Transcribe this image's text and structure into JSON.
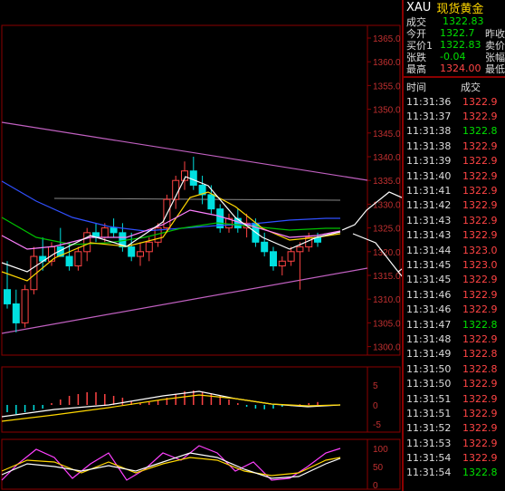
{
  "symbol": {
    "code": "XAU",
    "name": "现货黄金"
  },
  "quote": [
    {
      "label": "成交",
      "value": "1322.83",
      "value_color": "#00e000",
      "label2": ""
    },
    {
      "label": "今开",
      "value": "1322.7",
      "value_color": "#00e000",
      "label2": "昨收"
    },
    {
      "label": "买价1",
      "value": "1322.83",
      "value_color": "#00e000",
      "label2": "卖价"
    },
    {
      "label": "张跌",
      "value": "-0.04",
      "value_color": "#00e000",
      "label2": "张幅"
    },
    {
      "label": "最高",
      "value": "1324.00",
      "value_color": "#ff4444",
      "label2": "最低"
    }
  ],
  "ticks_header": {
    "time": "时间",
    "price": "成交"
  },
  "ticks": [
    {
      "time": "11:31:36",
      "price": "1322.9",
      "color": "#ff4444"
    },
    {
      "time": "11:31:37",
      "price": "1322.9",
      "color": "#ff4444"
    },
    {
      "time": "11:31:38",
      "price": "1322.8",
      "color": "#00e000"
    },
    {
      "time": "11:31:38",
      "price": "1322.9",
      "color": "#ff4444"
    },
    {
      "time": "11:31:39",
      "price": "1322.9",
      "color": "#ff4444"
    },
    {
      "time": "11:31:40",
      "price": "1322.9",
      "color": "#ff4444"
    },
    {
      "time": "11:31:41",
      "price": "1322.9",
      "color": "#ff4444"
    },
    {
      "time": "11:31:42",
      "price": "1322.9",
      "color": "#ff4444"
    },
    {
      "time": "11:31:43",
      "price": "1322.9",
      "color": "#ff4444"
    },
    {
      "time": "11:31:43",
      "price": "1322.9",
      "color": "#ff4444"
    },
    {
      "time": "11:31:44",
      "price": "1323.0",
      "color": "#ff4444"
    },
    {
      "time": "11:31:45",
      "price": "1323.0",
      "color": "#ff4444"
    },
    {
      "time": "11:31:45",
      "price": "1322.9",
      "color": "#ff4444"
    },
    {
      "time": "11:31:46",
      "price": "1322.9",
      "color": "#ff4444"
    },
    {
      "time": "11:31:46",
      "price": "1322.9",
      "color": "#ff4444"
    },
    {
      "time": "11:31:47",
      "price": "1322.8",
      "color": "#00e000"
    },
    {
      "time": "11:31:48",
      "price": "1322.9",
      "color": "#ff4444"
    },
    {
      "time": "11:31:49",
      "price": "1322.8",
      "color": "#ff4444"
    },
    {
      "time": "11:31:50",
      "price": "1322.8",
      "color": "#ff4444"
    },
    {
      "time": "11:31:50",
      "price": "1322.9",
      "color": "#ff4444"
    },
    {
      "time": "11:31:51",
      "price": "1322.9",
      "color": "#ff4444"
    },
    {
      "time": "11:31:51",
      "price": "1322.9",
      "color": "#ff4444"
    },
    {
      "time": "11:31:52",
      "price": "1322.9",
      "color": "#ff4444"
    },
    {
      "time": "11:31:53",
      "price": "1322.9",
      "color": "#ff4444"
    },
    {
      "time": "11:31:54",
      "price": "1322.9",
      "color": "#ff4444"
    },
    {
      "time": "11:31:54",
      "price": "1322.8",
      "color": "#00e000"
    }
  ],
  "price_axis": [
    "1365.0",
    "1360.0",
    "1355.0",
    "1350.0",
    "1345.0",
    "1340.0",
    "1335.0",
    "1330.0",
    "1325.0",
    "1320.0",
    "1315.0",
    "1310.0",
    "1305.0",
    "1300.0"
  ],
  "macd_axis": [
    "5",
    "0",
    "-5"
  ],
  "kdj_axis": [
    "100",
    "50",
    "0"
  ],
  "colors": {
    "up": "#ff4444",
    "down": "#00e0e0",
    "grid": "#8b0000",
    "gold": "#ffd700"
  }
}
